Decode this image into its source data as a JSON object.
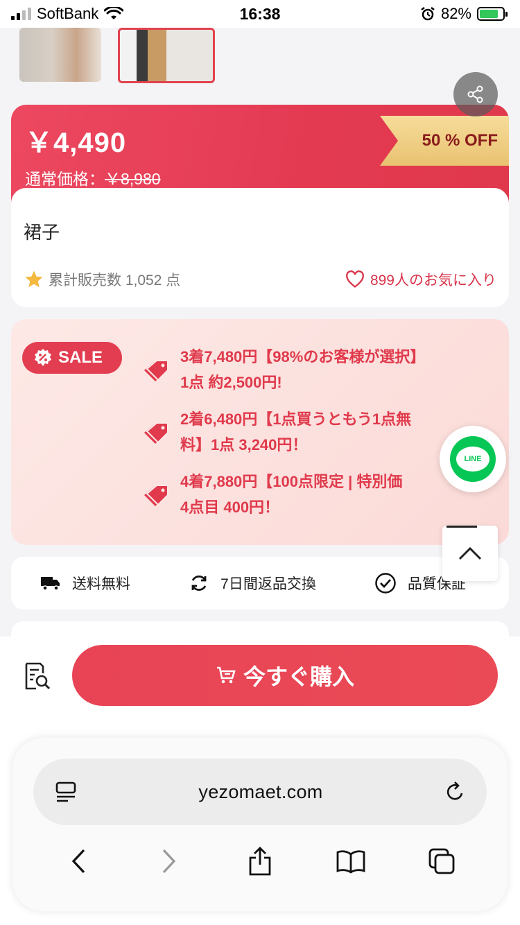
{
  "status_bar": {
    "carrier": "SoftBank",
    "time": "16:38",
    "battery": "82%"
  },
  "price_card": {
    "price": "￥4,490",
    "original_label": "通常価格：",
    "original_price": "￥8,980",
    "discount_badge": "50 % OFF",
    "product_name": "裙子",
    "sold_text": "累計販売数 1,052 点",
    "favorites_text": "899人のお気に入り"
  },
  "sale": {
    "badge_label": "SALE",
    "promotions": [
      {
        "line1": "3着7,480円【98%のお客様が選択】",
        "line2": "1点 約2,500円!"
      },
      {
        "line1": "2着6,480円【1点買うともう1点無",
        "line2": "料】1点 3,240円！"
      },
      {
        "line1": "4着7,880円【100点限定 | 特別価",
        "line2": "4点目 400円！"
      }
    ]
  },
  "line_button": {
    "label": "LINE"
  },
  "services": [
    {
      "icon": "truck-icon",
      "label": "送料無料"
    },
    {
      "icon": "refresh-icon",
      "label": "7日間返品交換"
    },
    {
      "icon": "check-circle-icon",
      "label": "品質保証"
    }
  ],
  "buy_bar": {
    "buy_label": "今すぐ購入"
  },
  "browser": {
    "url": "yezomaet.com"
  },
  "colors": {
    "accent": "#e33a52",
    "badge_gold": "#e9c271",
    "line_green": "#06c755"
  }
}
